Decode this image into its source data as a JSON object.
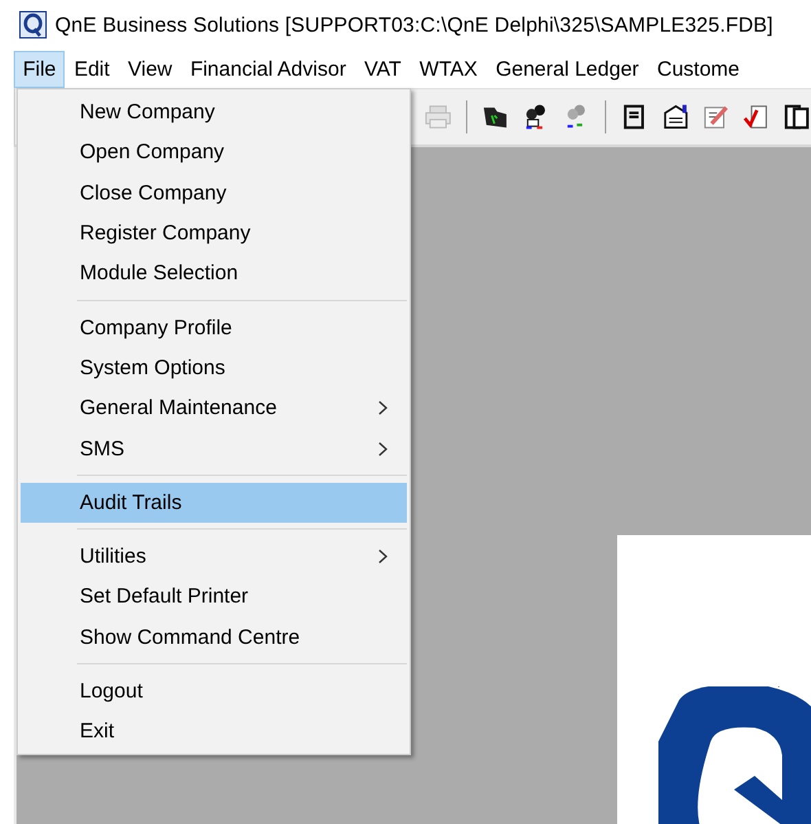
{
  "window": {
    "title": "QnE Business Solutions [SUPPORT03:C:\\QnE Delphi\\325\\SAMPLE325.FDB]"
  },
  "menubar": [
    {
      "label": "File",
      "selected": true
    },
    {
      "label": "Edit",
      "selected": false
    },
    {
      "label": "View",
      "selected": false
    },
    {
      "label": "Financial Advisor",
      "selected": false
    },
    {
      "label": "VAT",
      "selected": false
    },
    {
      "label": "WTAX",
      "selected": false
    },
    {
      "label": "General Ledger",
      "selected": false
    },
    {
      "label": "Custome",
      "selected": false
    }
  ],
  "file_menu": [
    {
      "kind": "item",
      "label": "New Company",
      "submenu": false,
      "selected": false
    },
    {
      "kind": "item",
      "label": "Open Company",
      "submenu": false,
      "selected": false
    },
    {
      "kind": "item",
      "label": "Close Company",
      "submenu": false,
      "selected": false
    },
    {
      "kind": "item",
      "label": "Register Company",
      "submenu": false,
      "selected": false
    },
    {
      "kind": "item",
      "label": "Module Selection",
      "submenu": false,
      "selected": false
    },
    {
      "kind": "separator"
    },
    {
      "kind": "item",
      "label": "Company Profile",
      "submenu": false,
      "selected": false
    },
    {
      "kind": "item",
      "label": "System Options",
      "submenu": false,
      "selected": false
    },
    {
      "kind": "item",
      "label": "General Maintenance",
      "submenu": true,
      "selected": false
    },
    {
      "kind": "item",
      "label": "SMS",
      "submenu": true,
      "selected": false
    },
    {
      "kind": "separator"
    },
    {
      "kind": "item",
      "label": "Audit Trails",
      "submenu": false,
      "selected": true
    },
    {
      "kind": "separator"
    },
    {
      "kind": "item",
      "label": "Utilities",
      "submenu": true,
      "selected": false
    },
    {
      "kind": "item",
      "label": "Set Default Printer",
      "submenu": false,
      "selected": false
    },
    {
      "kind": "item",
      "label": "Show Command Centre",
      "submenu": false,
      "selected": false
    },
    {
      "kind": "separator"
    },
    {
      "kind": "item",
      "label": "Logout",
      "submenu": false,
      "selected": false
    },
    {
      "kind": "item",
      "label": "Exit",
      "submenu": false,
      "selected": false
    }
  ]
}
